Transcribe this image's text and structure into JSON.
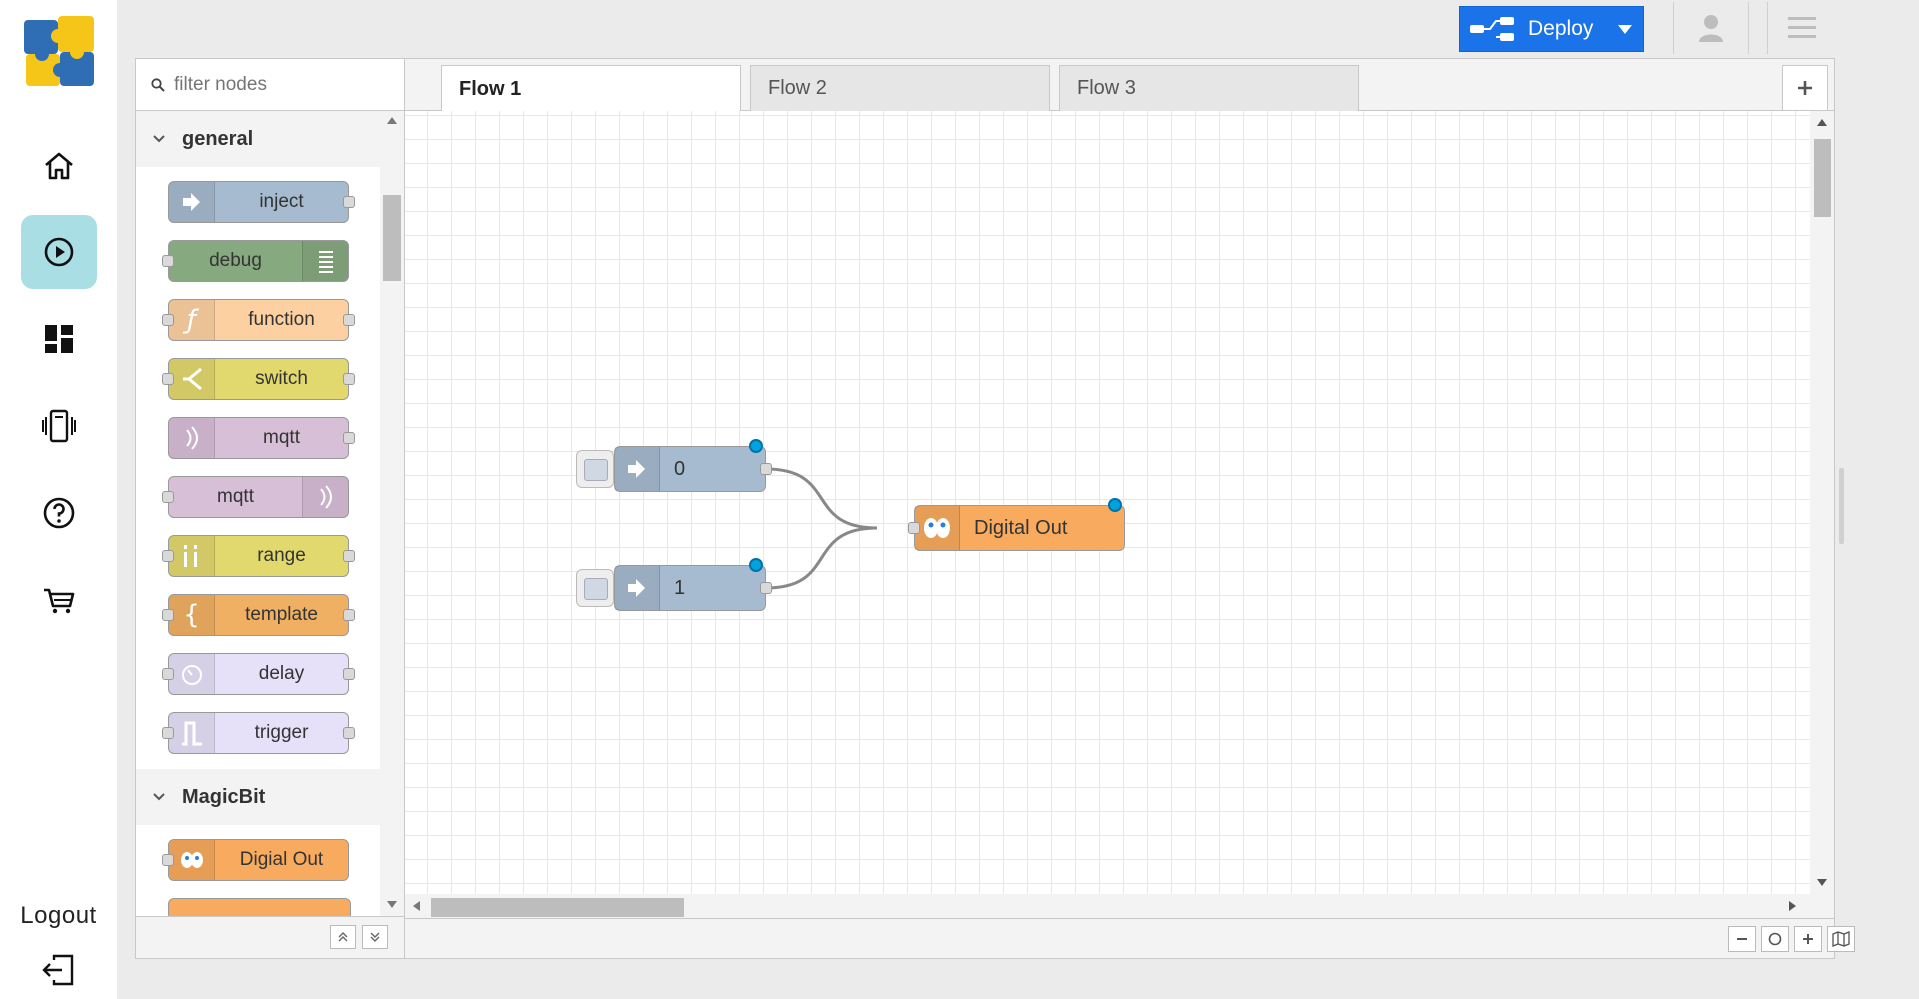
{
  "left_nav": {
    "items": [
      {
        "name": "home",
        "icon": "home-icon"
      },
      {
        "name": "flows",
        "icon": "play-circle-icon",
        "active": true
      },
      {
        "name": "dashboard",
        "icon": "dashboard-icon"
      },
      {
        "name": "devices",
        "icon": "device-icon"
      },
      {
        "name": "help",
        "icon": "help-icon"
      },
      {
        "name": "store",
        "icon": "cart-icon"
      }
    ],
    "logout_label": "Logout"
  },
  "header": {
    "deploy_label": "Deploy",
    "deploy_color": "#1a73e8"
  },
  "palette": {
    "filter_placeholder": "filter nodes",
    "categories": [
      {
        "label": "general",
        "nodes": [
          {
            "label": "inject",
            "color": "#a6bbcf"
          },
          {
            "label": "debug",
            "color": "#87a980"
          },
          {
            "label": "function",
            "color": "#fdd0a2"
          },
          {
            "label": "switch",
            "color": "#e2d96e"
          },
          {
            "label": "mqtt",
            "color": "#d8bfd8"
          },
          {
            "label": "mqtt",
            "color": "#d8bfd8"
          },
          {
            "label": "range",
            "color": "#e2d96e"
          },
          {
            "label": "template",
            "color": "#f0b063"
          },
          {
            "label": "delay",
            "color": "#e6e0f8"
          },
          {
            "label": "trigger",
            "color": "#e6e0f8"
          }
        ]
      },
      {
        "label": "MagicBit",
        "nodes": [
          {
            "label": "Digial Out",
            "color": "#f8ab5e"
          }
        ]
      }
    ]
  },
  "workspace": {
    "tabs": [
      {
        "label": "Flow 1",
        "active": true
      },
      {
        "label": "Flow 2",
        "active": false
      },
      {
        "label": "Flow 3",
        "active": false
      }
    ],
    "nodes": [
      {
        "id": "inject0",
        "type": "inject",
        "label": "0",
        "color": "#a6bbcf"
      },
      {
        "id": "inject1",
        "type": "inject",
        "label": "1",
        "color": "#a6bbcf"
      },
      {
        "id": "digitalout",
        "type": "digital-out",
        "label": "Digital Out",
        "color": "#f8ab5e"
      }
    ],
    "wires": [
      {
        "from": "inject0",
        "to": "digitalout"
      },
      {
        "from": "inject1",
        "to": "digitalout"
      }
    ]
  }
}
